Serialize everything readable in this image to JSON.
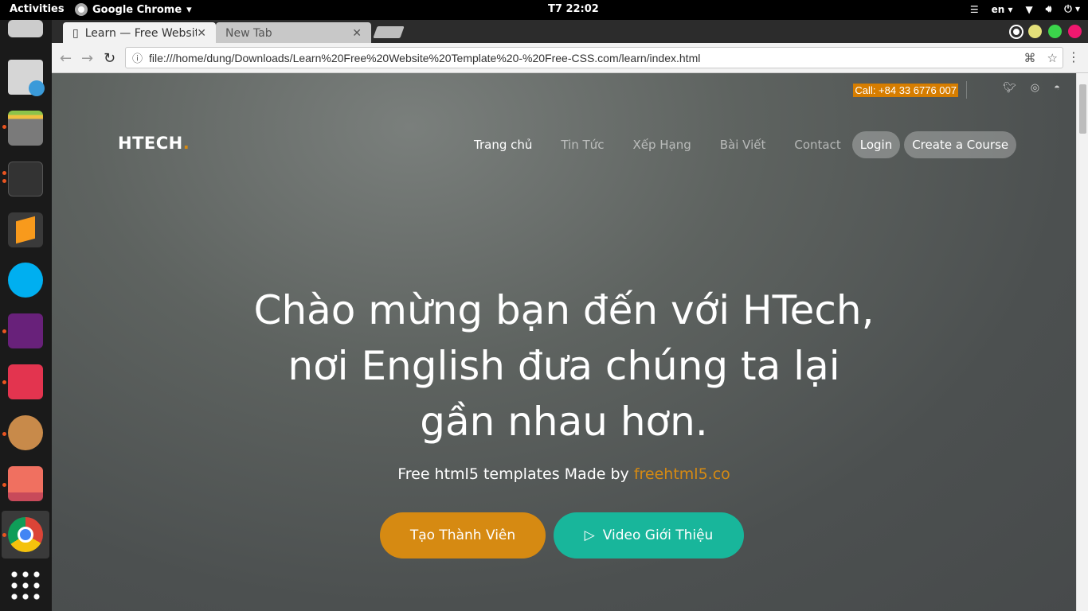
{
  "topbar": {
    "activities": "Activities",
    "app_name": "Google Chrome",
    "clock": "T7 22:02",
    "lang": "en"
  },
  "browser": {
    "tabs": [
      {
        "title": "Learn — Free Website",
        "active": true
      },
      {
        "title": "New Tab",
        "active": false
      }
    ],
    "url": "file:///home/dung/Downloads/Learn%20Free%20Website%20Template%20-%20Free-CSS.com/learn/index.html"
  },
  "page": {
    "call": "Call: +84 33 6776 007",
    "logo": "HTECH",
    "logo_dot": ".",
    "nav": [
      "Trang chủ",
      "Tin Tức",
      "Xếp Hạng",
      "Bài Viết",
      "Contact"
    ],
    "login": "Login",
    "create_course": "Create a Course",
    "hero_title": "Chào mừng bạn đến với HTech, nơi English đưa chúng ta lại gần nhau hơn.",
    "hero_sub_prefix": "Free html5 templates Made by ",
    "hero_sub_link": "freehtml5.co",
    "btn_primary": "Tạo Thành Viên",
    "btn_secondary": "Video Giới Thiệu"
  },
  "colors": {
    "accent": "#d68a12",
    "teal": "#18b69b"
  }
}
